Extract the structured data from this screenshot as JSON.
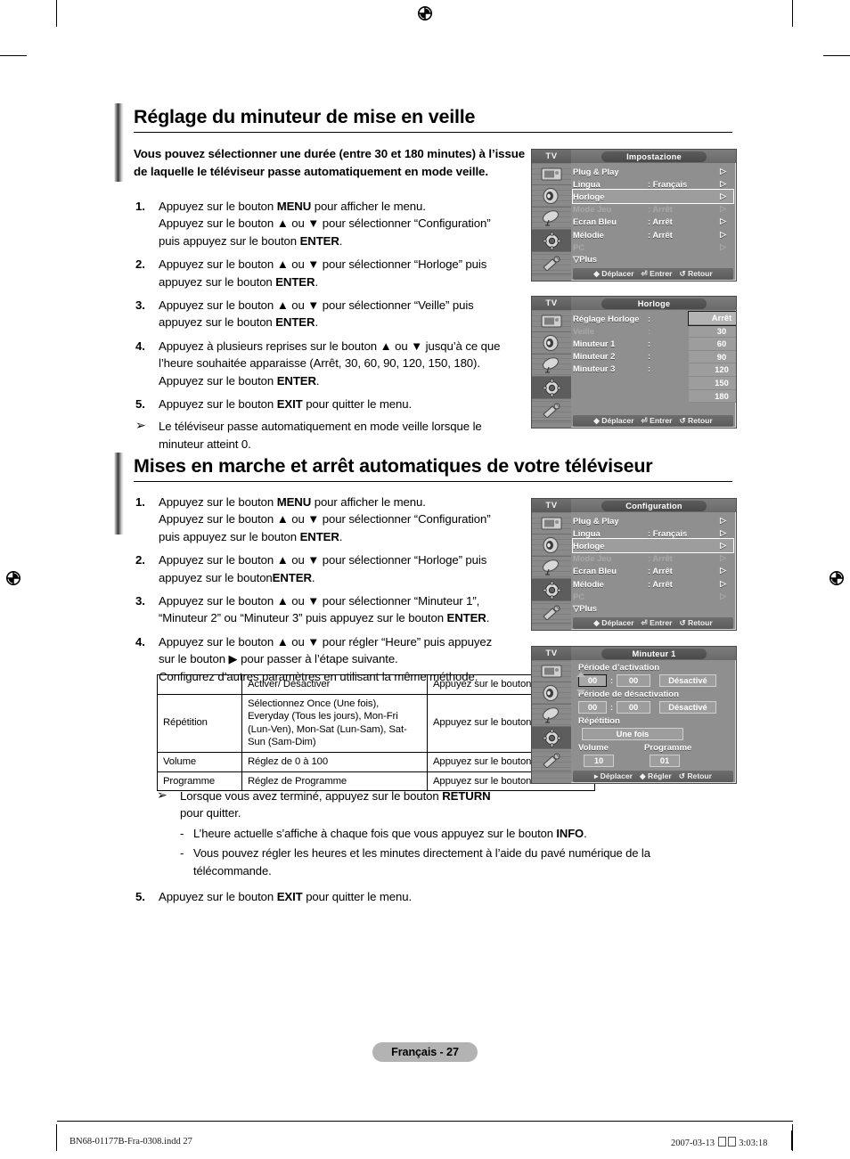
{
  "doc": {
    "section1": {
      "title": "Réglage du minuteur de mise en veille",
      "intro": "Vous pouvez sélectionner une durée (entre 30 et 180 minutes) à l’issue de laquelle le téléviseur passe automatiquement en mode veille.",
      "steps": [
        {
          "num": "1.",
          "lines": [
            "Appuyez sur le bouton <b>MENU</b> pour afficher le menu.",
            "Appuyez sur le bouton ▲ ou ▼ pour sélectionner “Configuration”",
            "puis appuyez sur le bouton <b>ENTER</b>."
          ]
        },
        {
          "num": "2.",
          "lines": [
            "Appuyez sur le bouton ▲ ou ▼ pour sélectionner “Horloge” puis",
            "appuyez sur le bouton <b>ENTER</b>."
          ]
        },
        {
          "num": "3.",
          "lines": [
            "Appuyez sur le bouton ▲ ou ▼ pour sélectionner “Veille” puis",
            "appuyez sur le bouton <b>ENTER</b>."
          ]
        },
        {
          "num": "4.",
          "lines": [
            "Appuyez à plusieurs reprises sur le bouton ▲ ou ▼ jusqu’à ce que",
            "l’heure souhaitée apparaisse (Arrêt, 30, 60, 90, 120, 150, 180).",
            "Appuyez sur le bouton <b>ENTER</b>."
          ]
        },
        {
          "num": "5.",
          "lines": [
            "Appuyez sur le bouton <b>EXIT</b> pour quitter le menu."
          ]
        }
      ],
      "note": {
        "glyph": "➢",
        "lines": [
          "Le téléviseur passe automatiquement en mode veille lorsque le",
          "minuteur atteint 0."
        ]
      }
    },
    "section2": {
      "title": "Mises en marche et arrêt automatiques de votre téléviseur",
      "steps": [
        {
          "num": "1.",
          "lines": [
            "Appuyez sur le bouton <b>MENU</b> pour afficher le menu.",
            "Appuyez sur le bouton ▲ ou ▼ pour sélectionner “Configuration”",
            "puis appuyez sur le bouton <b>ENTER</b>."
          ]
        },
        {
          "num": "2.",
          "lines": [
            "Appuyez sur le bouton ▲ ou ▼ pour sélectionner “Horloge” puis",
            "appuyez sur le bouton<b>ENTER</b>."
          ]
        },
        {
          "num": "3.",
          "lines": [
            "Appuyez sur le bouton ▲ ou ▼ pour sélectionner “Minuteur 1”,",
            "“Minuteur 2” ou “Minuteur 3” puis appuyez sur le bouton <b>ENTER</b>."
          ]
        },
        {
          "num": "4.",
          "lines": [
            "Appuyez sur le bouton ▲ ou ▼ pour régler “Heure” puis appuyez",
            "sur le bouton ▶ pour passer à l’étape suivante.",
            "Configurez d’autres paramètres en utilisant la même méthode."
          ]
        }
      ],
      "table": {
        "rows": [
          {
            "c1": "",
            "c2": "Activer/ Désactiver",
            "c3": "Appuyez sur le bouton ▲ ou ▼"
          },
          {
            "c1": "Répétition",
            "c2": "Sélectionnez Once (Une fois), Everyday (Tous les jours), Mon-Fri (Lun-Ven), Mon-Sat (Lun-Sam), Sat- Sun (Sam-Dim)",
            "c3": "Appuyez sur le bouton ▲ ou ▼"
          },
          {
            "c1": "Volume",
            "c2": "Réglez de 0 à 100",
            "c3": "Appuyez sur le bouton ▲ ou ▼"
          },
          {
            "c1": "Programme",
            "c2": "Réglez de Programme",
            "c3": "Appuyez sur le bouton ▲ ou ▼"
          }
        ]
      },
      "note": {
        "glyph": "➢",
        "lines": [
          "Lorsque vous avez terminé, appuyez sur le bouton <b>RETURN</b>",
          "pour quitter."
        ],
        "dashes": [
          "L’heure actuelle s’affiche à chaque fois que vous appuyez sur le bouton <b>INFO</b>.",
          "Vous pouvez régler les heures et les minutes directement à l’aide du pavé numérique de la télécommande."
        ]
      },
      "laststep": {
        "num": "5.",
        "lines": [
          "Appuyez sur le bouton <b>EXIT</b> pour quitter le menu."
        ]
      }
    },
    "footer": {
      "page_badge": "Français - 27",
      "print_left": "BN68-01177B-Fra-0308.indd   27",
      "print_right_date": "2007-03-13",
      "print_right_time": "3:03:18"
    }
  },
  "osd": {
    "tv_label": "TV",
    "chevron": "▷",
    "foot_move": "Déplacer",
    "foot_enter": "Entrer",
    "foot_return": "Retour",
    "foot_adjust": "Régler",
    "panel1": {
      "title": "Impostazione",
      "rows": [
        {
          "label": "Plug & Play",
          "value": "",
          "dim": false,
          "hl": false
        },
        {
          "label": "Lingua",
          "value": ": Français",
          "dim": false,
          "hl": false
        },
        {
          "label": "Horloge",
          "value": "",
          "dim": false,
          "hl": true
        },
        {
          "label": "Mode Jeu",
          "value": ": Arrêt",
          "dim": true,
          "hl": false
        },
        {
          "label": "Ecran Bleu",
          "value": ": Arrêt",
          "dim": false,
          "hl": false
        },
        {
          "label": "Mélodie",
          "value": ": Arrêt",
          "dim": false,
          "hl": false
        },
        {
          "label": "PC",
          "value": "",
          "dim": true,
          "hl": false
        },
        {
          "label": "▽Plus",
          "value": "",
          "dim": false,
          "hl": false,
          "nochev": true
        }
      ]
    },
    "panel2": {
      "title": "Horloge",
      "rows": [
        {
          "label": "Réglage Horloge",
          "colon": ":"
        },
        {
          "label": "Veille",
          "colon": ":",
          "dim": true
        },
        {
          "label": "Minuteur 1",
          "colon": ":"
        },
        {
          "label": "Minuteur 2",
          "colon": ":"
        },
        {
          "label": "Minuteur 3",
          "colon": ":"
        }
      ],
      "options": [
        "Arrêt",
        "30",
        "60",
        "90",
        "120",
        "150",
        "180"
      ],
      "selected_option": "Arrêt"
    },
    "panel3": {
      "title": "Configuration",
      "rows": [
        {
          "label": "Plug & Play",
          "value": "",
          "dim": false,
          "hl": false
        },
        {
          "label": "Lingua",
          "value": ": Français",
          "dim": false,
          "hl": false
        },
        {
          "label": "Horloge",
          "value": "",
          "dim": false,
          "hl": true
        },
        {
          "label": "Mode Jeu",
          "value": ": Arrêt",
          "dim": true,
          "hl": false
        },
        {
          "label": "Ecran Bleu",
          "value": ": Arrêt",
          "dim": false,
          "hl": false
        },
        {
          "label": "Mélodie",
          "value": ": Arrêt",
          "dim": false,
          "hl": false
        },
        {
          "label": "PC",
          "value": "",
          "dim": true,
          "hl": false
        },
        {
          "label": "▽Plus",
          "value": "",
          "dim": false,
          "hl": false,
          "nochev": true
        }
      ]
    },
    "panel4": {
      "title": "Minuteur 1",
      "on_header": "Période d’activation",
      "on_hour": "00",
      "on_min": "00",
      "on_state": "Désactivé",
      "off_header": "Période de désactivation",
      "off_hour": "00",
      "off_min": "00",
      "off_state": "Désactivé",
      "repeat_header": "Répétition",
      "repeat_value": "Une fois",
      "volume_header": "Volume",
      "volume_value": "10",
      "program_header": "Programme",
      "program_value": "01"
    }
  }
}
